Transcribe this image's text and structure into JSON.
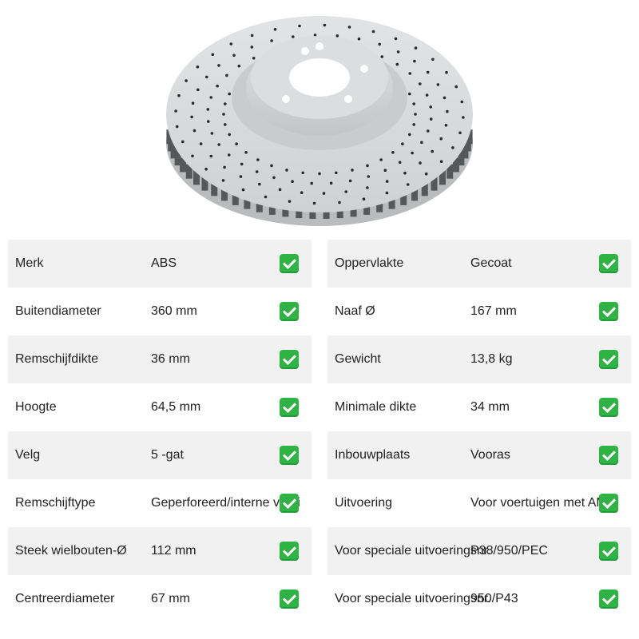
{
  "product_image": {
    "name": "brake-disc-image"
  },
  "colors": {
    "check": "#2fb344",
    "row_shade": "#f1f1f1",
    "disc": "#d4d6d8"
  },
  "specs_left": [
    {
      "label": "Merk",
      "value": "ABS"
    },
    {
      "label": "Buitendiameter",
      "value": "360 mm"
    },
    {
      "label": "Remschijfdikte",
      "value": "36 mm"
    },
    {
      "label": "Hoogte",
      "value": "64,5 mm"
    },
    {
      "label": "Velg",
      "value": "5 -gat"
    },
    {
      "label": "Remschijftype",
      "value": "Geperforeerd/interne venti"
    },
    {
      "label": "Steek wielbouten-Ø",
      "value": "112 mm"
    },
    {
      "label": "Centreerdiameter",
      "value": "67 mm"
    }
  ],
  "specs_right": [
    {
      "label": "Oppervlakte",
      "value": "Gecoat"
    },
    {
      "label": "Naaf Ø",
      "value": "167 mm"
    },
    {
      "label": "Gewicht",
      "value": "13,8 kg"
    },
    {
      "label": "Minimale dikte",
      "value": "34 mm"
    },
    {
      "label": "Inbouwplaats",
      "value": "Vooras"
    },
    {
      "label": "Uitvoering",
      "value": "Voor voertuigen met AMG"
    },
    {
      "label": "Voor speciale uitvoeringsnr.",
      "value": "P38/950/PEC"
    },
    {
      "label": "Voor speciale uitvoeringsnr.",
      "value": "950/P43"
    }
  ]
}
